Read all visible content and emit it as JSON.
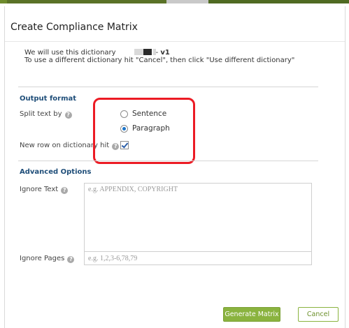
{
  "colors": {
    "accent_green": "#8ab33f",
    "section_heading": "#1f4e79",
    "highlight_red": "#ec1b24",
    "radio_blue": "#1a73c8"
  },
  "dialog": {
    "title": "Create Compliance Matrix"
  },
  "info": {
    "dict_prefix": "We will use this dictionary",
    "dict_suffix": "- ",
    "dict_version": "v1",
    "hint": "To use a different dictionary hit \"Cancel\", then click \"Use different dictionary\""
  },
  "output_format": {
    "heading": "Output format",
    "split_label": "Split text by",
    "options": [
      {
        "label": "Sentence",
        "checked": false
      },
      {
        "label": "Paragraph",
        "checked": true
      }
    ],
    "new_row_label": "New row on dictionary hit",
    "new_row_checked": true
  },
  "advanced": {
    "heading": "Advanced Options",
    "ignore_text_label": "Ignore Text",
    "ignore_text_placeholder": "e.g. APPENDIX, COPYRIGHT",
    "ignore_pages_label": "Ignore Pages",
    "ignore_pages_placeholder": "e.g. 1,2,3-6,78,79"
  },
  "icons": {
    "help": "help-icon",
    "help_glyph": "?"
  },
  "buttons": {
    "generate": "Generate Matrix",
    "cancel": "Cancel"
  }
}
